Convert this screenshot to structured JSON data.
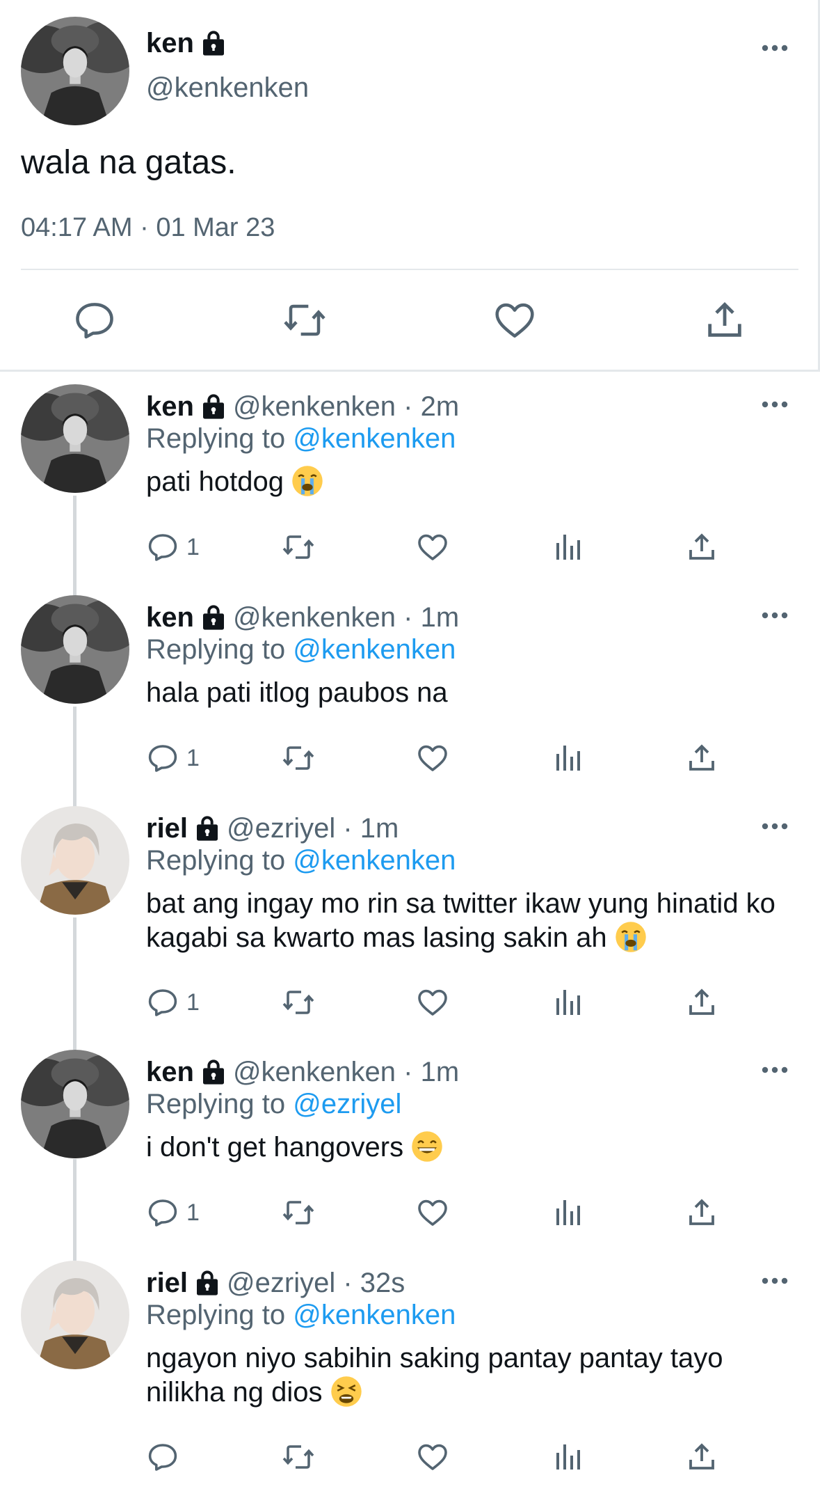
{
  "main_tweet": {
    "name": "ken",
    "handle": "@kenkenken",
    "text": "wala na gatas.",
    "timestamp": "04:17 AM · 01 Mar 23",
    "actions": [
      "reply-icon",
      "retweet-icon",
      "like-icon",
      "share-icon"
    ],
    "lock_icon": "lock-icon",
    "more_icon": "more-icon"
  },
  "replies": [
    {
      "name": "ken",
      "handle_time": "@kenkenken · 2m",
      "replying_label": "Replying to",
      "replying_to": "@kenkenken",
      "text": "pati hotdog",
      "emoji": "crying-face",
      "reply_count": "1",
      "avatar": "ken"
    },
    {
      "name": "ken",
      "handle_time": "@kenkenken · 1m",
      "replying_label": "Replying to",
      "replying_to": "@kenkenken",
      "text": "hala pati itlog paubos na",
      "emoji": "",
      "reply_count": "1",
      "avatar": "ken"
    },
    {
      "name": "riel",
      "handle_time": "@ezriyel · 1m",
      "replying_label": "Replying to",
      "replying_to": "@kenkenken",
      "text": "bat ang ingay mo rin sa twitter ikaw yung hinatid ko kagabi sa kwarto mas lasing sakin ah",
      "emoji": "crying-face",
      "reply_count": "1",
      "avatar": "riel"
    },
    {
      "name": "ken",
      "handle_time": "@kenkenken · 1m",
      "replying_label": "Replying to",
      "replying_to": "@ezriyel",
      "text": "i don't get hangovers",
      "emoji": "grinning-face",
      "reply_count": "1",
      "avatar": "ken"
    },
    {
      "name": "riel",
      "handle_time": "@ezriyel · 32s",
      "replying_label": "Replying to",
      "replying_to": "@kenkenken",
      "text": "ngayon niyo sabihin saking pantay pantay tayo nilikha ng dios",
      "emoji": "weary-face",
      "reply_count": "",
      "avatar": "riel"
    }
  ],
  "colors": {
    "text": "#0f1419",
    "secondary": "#536471",
    "link": "#1d9bf0",
    "divider": "#e4e8eb",
    "thread_line": "#d4d8db"
  }
}
